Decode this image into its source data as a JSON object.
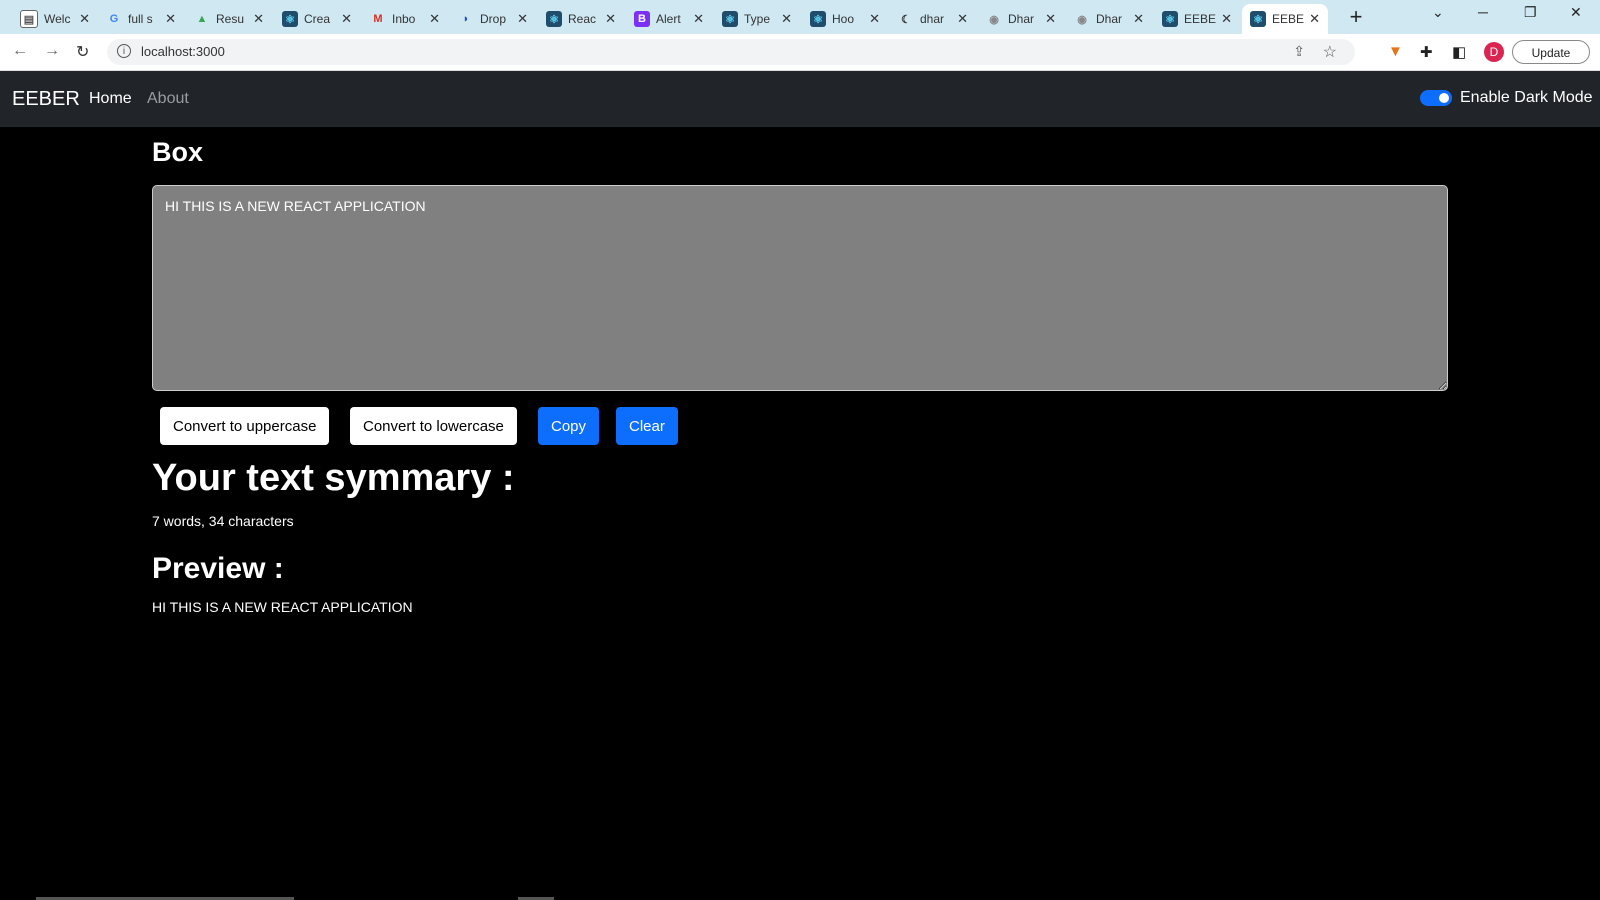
{
  "browser": {
    "tabs": [
      {
        "title": "Welc",
        "favicon": "page-icon",
        "color": "#555"
      },
      {
        "title": "full s",
        "favicon": "google-icon",
        "color": "#4285f4"
      },
      {
        "title": "Resu",
        "favicon": "drive-icon",
        "color": "#34a853"
      },
      {
        "title": "Crea",
        "favicon": "react-icon",
        "color": "#1f4d6b"
      },
      {
        "title": "Inbo",
        "favicon": "gmail-icon",
        "color": "#d93025"
      },
      {
        "title": "Drop",
        "favicon": "drop-icon",
        "color": "#1a4fd6"
      },
      {
        "title": "Reac",
        "favicon": "react-icon",
        "color": "#1f4d6b"
      },
      {
        "title": "Alert",
        "favicon": "bootstrap-icon",
        "color": "#7b2ff7"
      },
      {
        "title": "Type",
        "favicon": "react-icon",
        "color": "#1f4d6b"
      },
      {
        "title": "Hoo",
        "favicon": "react-icon",
        "color": "#1f4d6b"
      },
      {
        "title": "dhar",
        "favicon": "moon-icon",
        "color": "#333"
      },
      {
        "title": "Dhar",
        "favicon": "github-icon",
        "color": "#888"
      },
      {
        "title": "Dhar",
        "favicon": "github-icon",
        "color": "#888"
      },
      {
        "title": "EEBE",
        "favicon": "react-icon",
        "color": "#1f4d6b"
      },
      {
        "title": "EEBE",
        "favicon": "react-icon",
        "color": "#1f4d6b",
        "active": true
      }
    ],
    "url": "localhost:3000",
    "update_label": "Update",
    "avatar_initial": "D"
  },
  "navbar": {
    "brand": "EEBER",
    "links": [
      "Home",
      "About"
    ],
    "toggle_label": "Enable Dark Mode",
    "dark_mode_enabled": true
  },
  "main": {
    "heading": "Box",
    "textarea_value": "HI THIS IS A NEW REACT APPLICATION",
    "buttons": {
      "uppercase": "Convert to uppercase",
      "lowercase": "Convert to lowercase",
      "copy": "Copy",
      "clear": "Clear"
    },
    "summary_heading": "Your text symmary :",
    "summary_stats": "7 words, 34 characters",
    "preview_heading": "Preview :",
    "preview_text": "HI THIS IS A NEW REACT APPLICATION"
  },
  "colors": {
    "primary": "#0d6efd",
    "navbar_bg": "#212529",
    "page_bg": "#000000",
    "textarea_bg": "#808080"
  }
}
